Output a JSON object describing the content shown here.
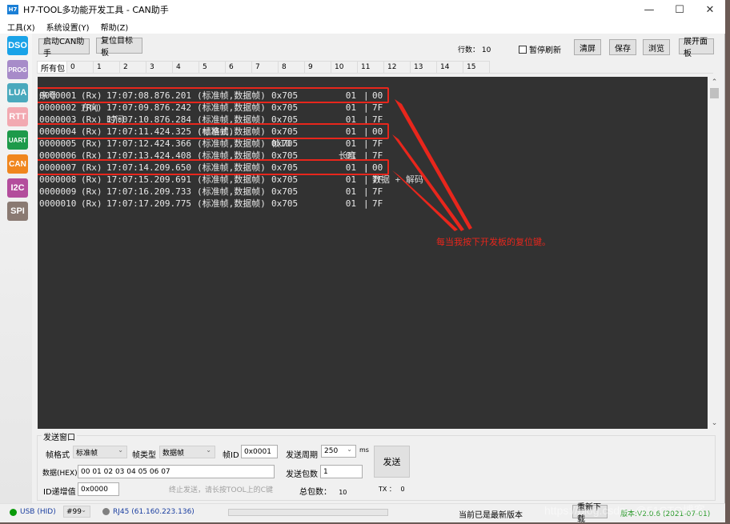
{
  "window": {
    "app_icon_label": "H7",
    "title": "H7-TOOL多功能开发工具 - CAN助手",
    "controls": {
      "minimize": "—",
      "maximize": "☐",
      "close": "✕"
    }
  },
  "menu": [
    {
      "label": "工具(X)"
    },
    {
      "label": "系统设置(Y)"
    },
    {
      "label": "帮助(Z)"
    }
  ],
  "sidebar": {
    "items": [
      {
        "label": "DSO",
        "color": "#1aa3e8"
      },
      {
        "label": "PROG",
        "color": "#a78bc9"
      },
      {
        "label": "LUA",
        "color": "#4aa9bd"
      },
      {
        "label": "RTT",
        "color": "#f2a9b1"
      },
      {
        "label": "UART",
        "color": "#1d9a4a"
      },
      {
        "label": "CAN",
        "color": "#f0861e"
      },
      {
        "label": "I2C",
        "color": "#b34d9c"
      },
      {
        "label": "SPI",
        "color": "#8a7a72"
      }
    ]
  },
  "toolbar": {
    "start_can": "启动CAN助手",
    "reset_target": "复位目标板",
    "rows_label": "行数：",
    "rows_value": "10",
    "pause_refresh": "暂停刷新",
    "clear": "清屏",
    "save": "保存",
    "browse": "浏览",
    "expand_panel": "展开面板"
  },
  "tabs": [
    "所有包",
    "0",
    "1",
    "2",
    "3",
    "4",
    "5",
    "6",
    "7",
    "8",
    "9",
    "10",
    "11",
    "12",
    "13",
    "14",
    "15"
  ],
  "log": {
    "headers": {
      "seq": "序号",
      "dir": "方向",
      "time": "时间",
      "fmt": "(帧格式)",
      "id": "帧ID",
      "len": "长度",
      "sep": "|",
      "data": "数据 + 解码"
    },
    "rows": [
      {
        "seq": "0000001",
        "dir": "(Rx)",
        "time": "17:07:08.876.201",
        "fmt": "(标准帧,数据帧)",
        "id": "0x705",
        "len": "01",
        "data": "00",
        "highlight": true
      },
      {
        "seq": "0000002",
        "dir": "(Rx)",
        "time": "17:07:09.876.242",
        "fmt": "(标准帧,数据帧)",
        "id": "0x705",
        "len": "01",
        "data": "7F",
        "highlight": false
      },
      {
        "seq": "0000003",
        "dir": "(Rx)",
        "time": "17:07:10.876.284",
        "fmt": "(标准帧,数据帧)",
        "id": "0x705",
        "len": "01",
        "data": "7F",
        "highlight": false
      },
      {
        "seq": "0000004",
        "dir": "(Rx)",
        "time": "17:07:11.424.325",
        "fmt": "(标准帧,数据帧)",
        "id": "0x705",
        "len": "01",
        "data": "00",
        "highlight": true
      },
      {
        "seq": "0000005",
        "dir": "(Rx)",
        "time": "17:07:12.424.366",
        "fmt": "(标准帧,数据帧)",
        "id": "0x705",
        "len": "01",
        "data": "7F",
        "highlight": false
      },
      {
        "seq": "0000006",
        "dir": "(Rx)",
        "time": "17:07:13.424.408",
        "fmt": "(标准帧,数据帧)",
        "id": "0x705",
        "len": "01",
        "data": "7F",
        "highlight": false
      },
      {
        "seq": "0000007",
        "dir": "(Rx)",
        "time": "17:07:14.209.650",
        "fmt": "(标准帧,数据帧)",
        "id": "0x705",
        "len": "01",
        "data": "00",
        "highlight": true
      },
      {
        "seq": "0000008",
        "dir": "(Rx)",
        "time": "17:07:15.209.691",
        "fmt": "(标准帧,数据帧)",
        "id": "0x705",
        "len": "01",
        "data": "7F",
        "highlight": false
      },
      {
        "seq": "0000009",
        "dir": "(Rx)",
        "time": "17:07:16.209.733",
        "fmt": "(标准帧,数据帧)",
        "id": "0x705",
        "len": "01",
        "data": "7F",
        "highlight": false
      },
      {
        "seq": "0000010",
        "dir": "(Rx)",
        "time": "17:07:17.209.775",
        "fmt": "(标准帧,数据帧)",
        "id": "0x705",
        "len": "01",
        "data": "7F",
        "highlight": false
      }
    ],
    "annotation": "每当我按下开发板的复位键。",
    "annotation_color": "#e8261c"
  },
  "send": {
    "group_title": "发送窗口",
    "frame_format_label": "帧格式",
    "frame_format_value": "标准帧",
    "frame_type_label": "帧类型",
    "frame_type_value": "数据帧",
    "frame_id_label": "帧ID",
    "frame_id_value": "0x0001",
    "period_label": "发送周期",
    "period_value": "250",
    "period_unit": "ms",
    "data_label": "数据(HEX)",
    "data_value": "00 01 02 03 04 05 06 07",
    "count_label": "发送包数",
    "count_value": "1",
    "id_inc_label": "ID递增值",
    "id_inc_value": "0x0000",
    "hint": "终止发送，请长按TOOL上的C键",
    "total_label": "总包数：",
    "total_value": "10",
    "tx_label": "TX ：",
    "tx_value": "0",
    "send_button": "发送"
  },
  "status": {
    "usb_label": "USB (HID)",
    "usb_color": "#0a9a0a",
    "port_value": "#99",
    "rj45_label": "RJ45 (61.160.223.136)",
    "rj45_color": "#808080",
    "update_status": "当前已是最新版本",
    "redownload": "重新下载",
    "version": "版本:V2.0.6 (2021-07-01)",
    "version_color": "#2a9a2a",
    "watermark": "https://blog.csdn...@51CTO博客"
  }
}
